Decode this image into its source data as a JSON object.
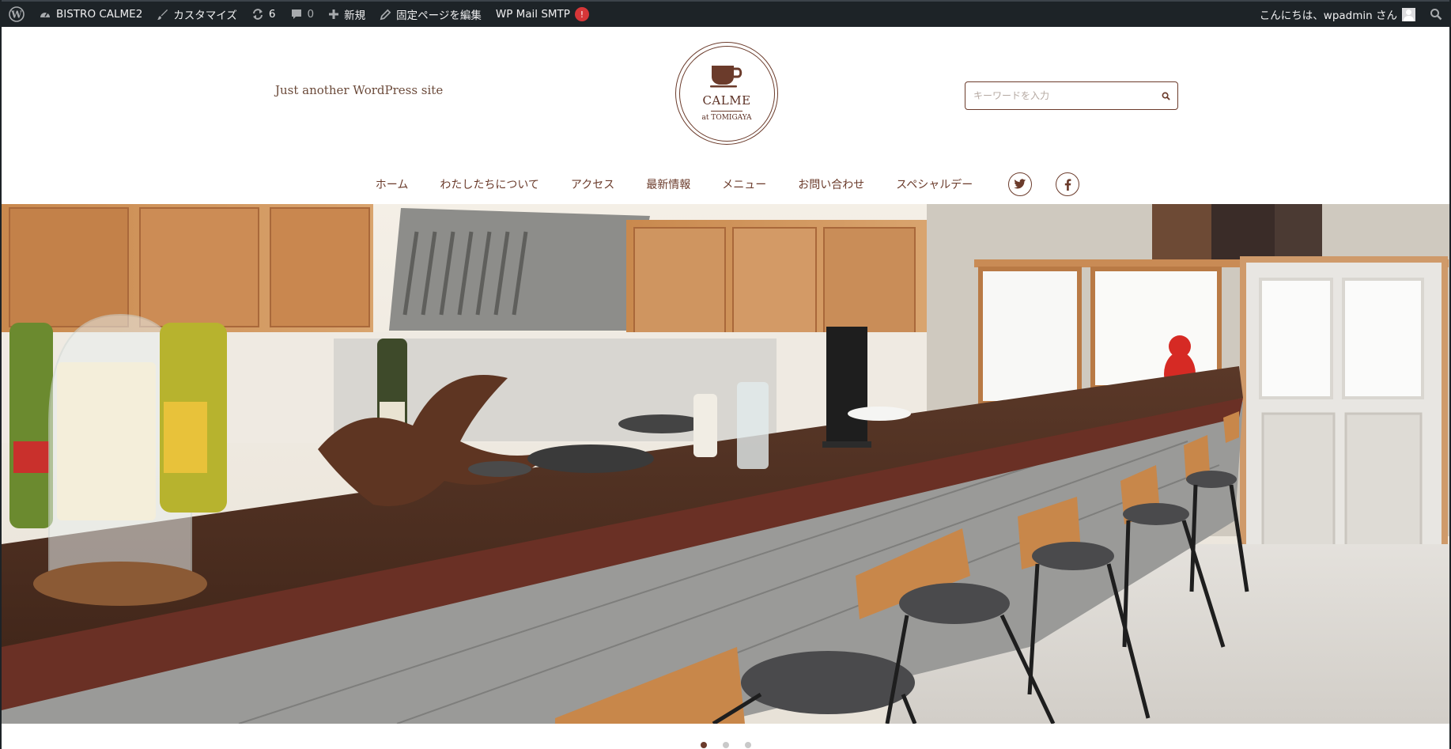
{
  "adminbar": {
    "site_name": "BISTRO CALME2",
    "customize": "カスタマイズ",
    "updates_count": "6",
    "comments_count": "0",
    "new": "新規",
    "edit_page": "固定ページを編集",
    "mail_smtp": "WP Mail SMTP",
    "mail_badge": "!",
    "greeting": "こんにちは、wpadmin さん"
  },
  "header": {
    "tagline": "Just another WordPress site",
    "logo_name": "CALME",
    "logo_sub": "at TOMIGAYA",
    "search_placeholder": "キーワードを入力"
  },
  "nav": {
    "items": [
      "ホーム",
      "わたしたちについて",
      "アクセス",
      "最新情報",
      "メニュー",
      "お問い合わせ",
      "スペシャルデー"
    ]
  },
  "slider": {
    "total": 3,
    "active": 1
  },
  "colors": {
    "brand": "#6b3b2b",
    "adminbar": "#1d2327",
    "badge": "#d63638"
  }
}
